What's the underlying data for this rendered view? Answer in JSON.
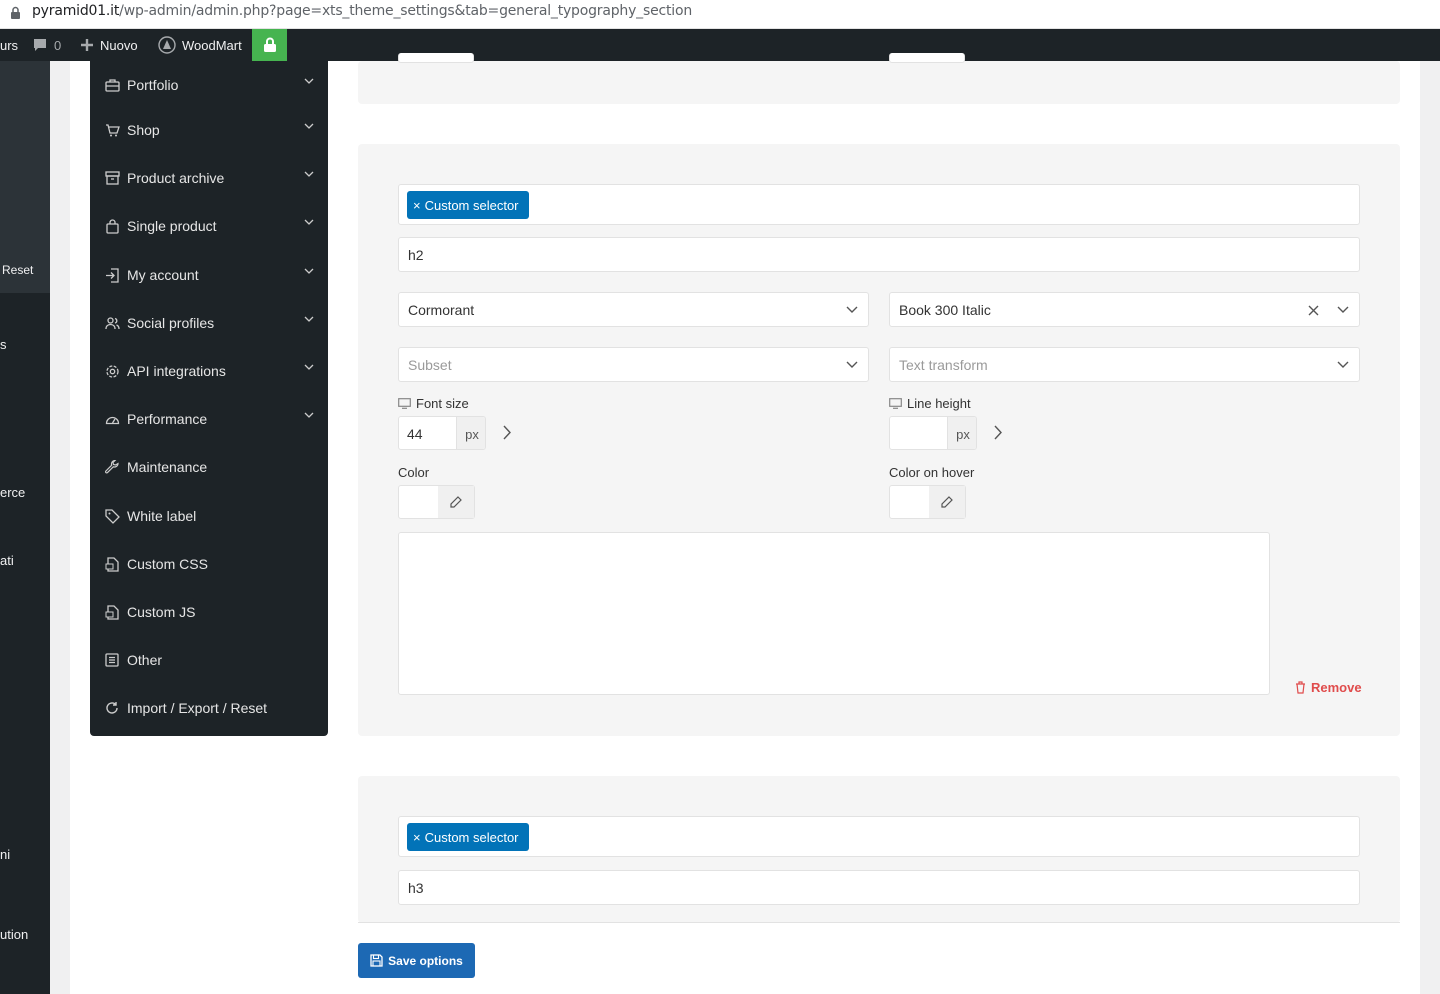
{
  "browser": {
    "url_host": "pyramid01.it",
    "url_path": "/wp-admin/admin.php?page=xts_theme_settings&tab=general_typography_section"
  },
  "adminbar": {
    "partial_left": "urs",
    "comments_count": "0",
    "new_label": "Nuovo",
    "site_label": "WoodMart"
  },
  "wp_menu": {
    "fragments": [
      "Reset",
      "s",
      "erce",
      "ati",
      "ni",
      "ution"
    ]
  },
  "theme_nav": {
    "items": [
      {
        "label": "Portfolio",
        "icon": "briefcase-icon",
        "has_children": true
      },
      {
        "label": "Shop",
        "icon": "cart-icon",
        "has_children": true
      },
      {
        "label": "Product archive",
        "icon": "archive-icon",
        "has_children": true
      },
      {
        "label": "Single product",
        "icon": "bag-icon",
        "has_children": true
      },
      {
        "label": "My account",
        "icon": "login-icon",
        "has_children": true
      },
      {
        "label": "Social profiles",
        "icon": "users-icon",
        "has_children": true
      },
      {
        "label": "API integrations",
        "icon": "gear-icon",
        "has_children": true
      },
      {
        "label": "Performance",
        "icon": "gauge-icon",
        "has_children": true
      },
      {
        "label": "Maintenance",
        "icon": "wrench-icon",
        "has_children": false
      },
      {
        "label": "White label",
        "icon": "tag-icon",
        "has_children": false
      },
      {
        "label": "Custom CSS",
        "icon": "css-file-icon",
        "has_children": false
      },
      {
        "label": "Custom JS",
        "icon": "js-file-icon",
        "has_children": false
      },
      {
        "label": "Other",
        "icon": "sliders-icon",
        "has_children": false
      },
      {
        "label": "Import / Export / Reset",
        "icon": "refresh-icon",
        "has_children": false
      }
    ]
  },
  "typography_block_1": {
    "selector_tag": "Custom selector",
    "selector_value": "h2",
    "font_family": "Cormorant",
    "font_weight": "Book 300 Italic",
    "subset_placeholder": "Subset",
    "text_transform_placeholder": "Text transform",
    "font_size_label": "Font size",
    "font_size_value": "44",
    "font_size_unit": "px",
    "line_height_label": "Line height",
    "line_height_value": "",
    "line_height_unit": "px",
    "color_label": "Color",
    "color_hover_label": "Color on hover",
    "remove_label": "Remove"
  },
  "typography_block_2": {
    "selector_tag": "Custom selector",
    "selector_value": "h3"
  },
  "save_button": "Save options",
  "colors": {
    "admin_bar": "#1d2327",
    "tag_blue": "#0273b8",
    "save_blue": "#1d69b4",
    "lock_green": "#46b450",
    "remove_red": "#e04c4c"
  }
}
